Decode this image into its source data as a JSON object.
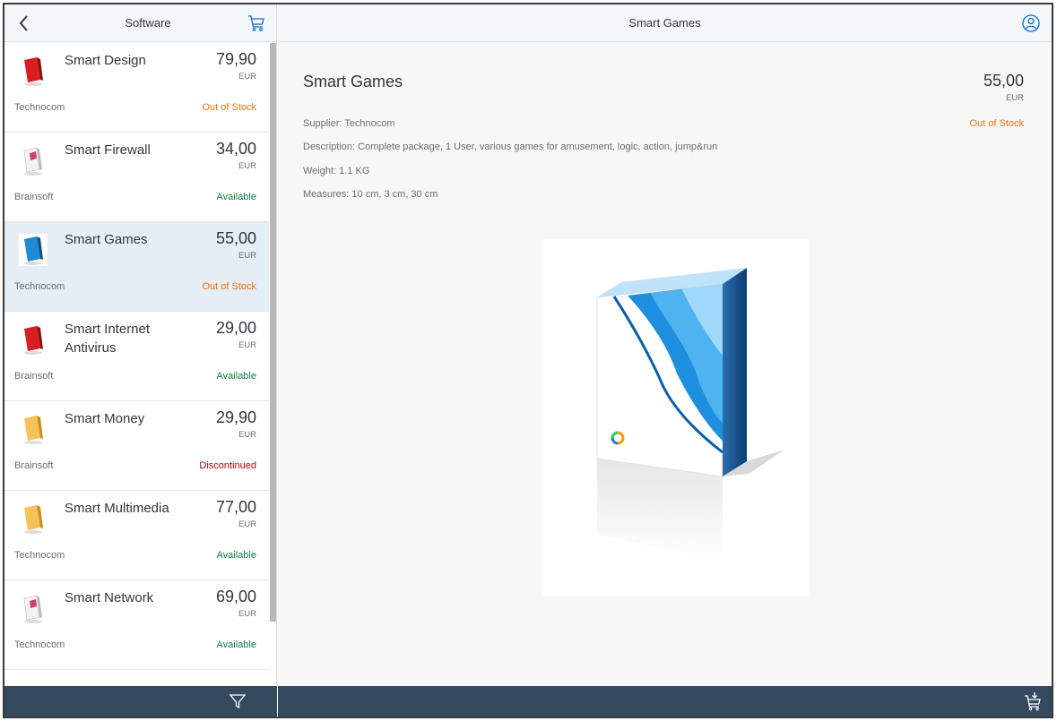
{
  "master": {
    "title": "Software",
    "items": [
      {
        "name": "Smart Design",
        "price": "79,90",
        "currency": "EUR",
        "supplier": "Technocom",
        "status": "Out of Stock",
        "icon": "red-box-icon"
      },
      {
        "name": "Smart Firewall",
        "price": "34,00",
        "currency": "EUR",
        "supplier": "Brainsoft",
        "status": "Available",
        "icon": "pink-box-icon"
      },
      {
        "name": "Smart Games",
        "price": "55,00",
        "currency": "EUR",
        "supplier": "Technocom",
        "status": "Out of Stock",
        "icon": "blue-box-icon"
      },
      {
        "name": "Smart Internet Antivirus",
        "price": "29,00",
        "currency": "EUR",
        "supplier": "Brainsoft",
        "status": "Available",
        "icon": "red-box-icon"
      },
      {
        "name": "Smart Money",
        "price": "29,90",
        "currency": "EUR",
        "supplier": "Brainsoft",
        "status": "Discontinued",
        "icon": "yellow-box-icon"
      },
      {
        "name": "Smart Multimedia",
        "price": "77,00",
        "currency": "EUR",
        "supplier": "Technocom",
        "status": "Available",
        "icon": "yellow-box-icon"
      },
      {
        "name": "Smart Network",
        "price": "69,00",
        "currency": "EUR",
        "supplier": "Technocom",
        "status": "Available",
        "icon": "pink-box-icon"
      }
    ]
  },
  "detail": {
    "header_title": "Smart Games",
    "title": "Smart Games",
    "price": "55,00",
    "currency": "EUR",
    "status": "Out of Stock",
    "supplier": "Supplier: Technocom",
    "description": "Description: Complete package, 1 User, various games for amusement, logic, action, jump&run",
    "weight": "Weight: 1.1 KG",
    "measures": "Measures: 10 cm, 3 cm, 30 cm",
    "image_icon": "software-box-image"
  },
  "colors": {
    "footer": "#354a5f",
    "header": "#f4f7fa",
    "selected_row": "#e5edf5",
    "status_out_of_stock": "#e9730c",
    "status_available": "#107e3e",
    "status_discontinued": "#bb0000"
  }
}
